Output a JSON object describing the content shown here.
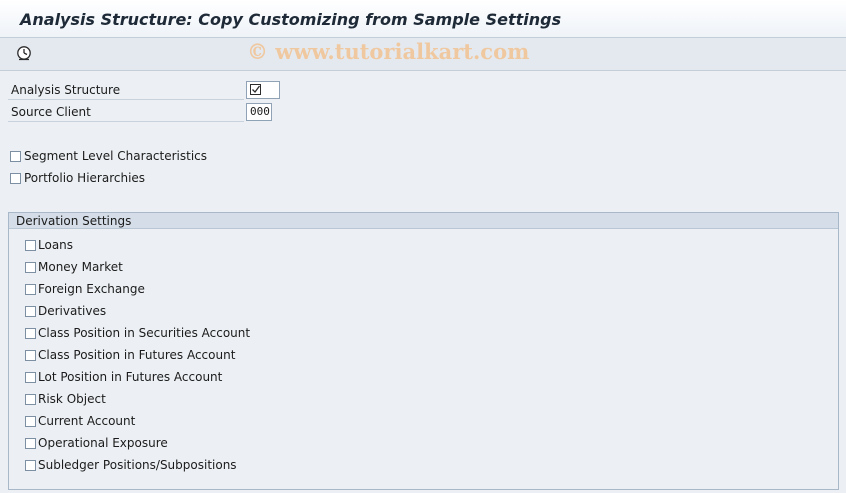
{
  "window": {
    "title": "Analysis Structure: Copy Customizing from Sample Settings"
  },
  "toolbar": {
    "execute_icon": "execute-clock-icon"
  },
  "watermark": "© www.tutorialkart.com",
  "fields": {
    "analysis_structure": {
      "label": "Analysis Structure",
      "value": "",
      "checked": true
    },
    "source_client": {
      "label": "Source Client",
      "value": "000"
    }
  },
  "options": {
    "segment_level": {
      "label": "Segment Level Characteristics",
      "checked": false
    },
    "portfolio_hierarchies": {
      "label": "Portfolio Hierarchies",
      "checked": false
    }
  },
  "derivation": {
    "title": "Derivation Settings",
    "items": [
      {
        "label": "Loans",
        "checked": false
      },
      {
        "label": "Money Market",
        "checked": false
      },
      {
        "label": "Foreign Exchange",
        "checked": false
      },
      {
        "label": "Derivatives",
        "checked": false
      },
      {
        "label": "Class Position in Securities Account",
        "checked": false
      },
      {
        "label": "Class Position in Futures Account",
        "checked": false
      },
      {
        "label": "Lot Position in Futures Account",
        "checked": false
      },
      {
        "label": "Risk Object",
        "checked": false
      },
      {
        "label": "Current Account",
        "checked": false
      },
      {
        "label": "Operational Exposure",
        "checked": false
      },
      {
        "label": "Subledger Positions/Subpositions",
        "checked": false
      }
    ]
  }
}
